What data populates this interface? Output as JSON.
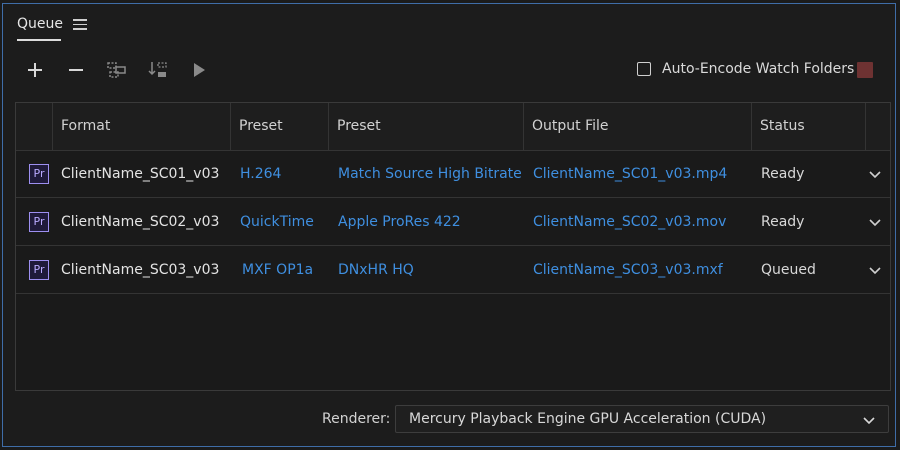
{
  "panel": {
    "tab_label": "Queue",
    "menu_icon": "hamburger-icon"
  },
  "toolbar": {
    "icons": [
      "plus-icon",
      "minus-icon",
      "duplicate-icon",
      "move-down-icon",
      "play-icon"
    ],
    "auto_encode_label": "Auto-Encode Watch Folders",
    "auto_encode_checked": false,
    "stop_color": "#6e3232"
  },
  "table": {
    "headers": [
      "Format",
      "Preset",
      "Preset",
      "Output File",
      "Status"
    ],
    "rows": [
      {
        "name": "ClientName_SC01_v03",
        "format": "H.264",
        "preset": "Match Source High Bitrate",
        "output": "ClientName_SC01_v03.mp4",
        "status": "Ready"
      },
      {
        "name": "ClientName_SC02_v03",
        "format": "QuickTime",
        "preset": "Apple ProRes 422",
        "output": "ClientName_SC02_v03.mov",
        "status": "Ready"
      },
      {
        "name": "ClientName_SC03_v03",
        "format": "MXF OP1a",
        "preset": "DNxHR HQ",
        "output": "ClientName_SC03_v03.mxf",
        "status": "Queued"
      }
    ],
    "app_icon_text": "Pr"
  },
  "footer": {
    "renderer_label": "Renderer:",
    "renderer_value": "Mercury Playback Engine GPU Acceleration (CUDA)"
  },
  "colors": {
    "accent_border": "#3f6da8",
    "link_blue": "#3f8fe0",
    "premiere_purple": "#9d8ff0"
  }
}
